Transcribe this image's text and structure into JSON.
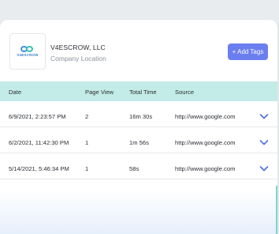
{
  "company": {
    "logo_text": "V4ESCROW",
    "name": "V4ESCROW, LLC",
    "location": "Company Location"
  },
  "actions": {
    "add_tags_label": "+ Add Tags"
  },
  "table": {
    "headers": {
      "date": "Date",
      "page_view": "Page View",
      "total_time": "Total Time",
      "source": "Source"
    },
    "rows": [
      {
        "date": "6/9/2021, 2:23:57 PM",
        "page_view": "2",
        "total_time": "16m 30s",
        "source": "http://www.google.com"
      },
      {
        "date": "6/2/2021, 11:42:30 PM",
        "page_view": "1",
        "total_time": "1m 56s",
        "source": "http://www.google.com"
      },
      {
        "date": "5/14/2021, 5:46:34 PM",
        "page_view": "1",
        "total_time": "58s",
        "source": "http://www.google.com"
      }
    ]
  },
  "colors": {
    "header_bg": "#c3ebe7",
    "button_bg": "#6b7ef0",
    "chevron": "#4f6fd8"
  },
  "icons": {
    "expand": "chevron-down-icon"
  }
}
